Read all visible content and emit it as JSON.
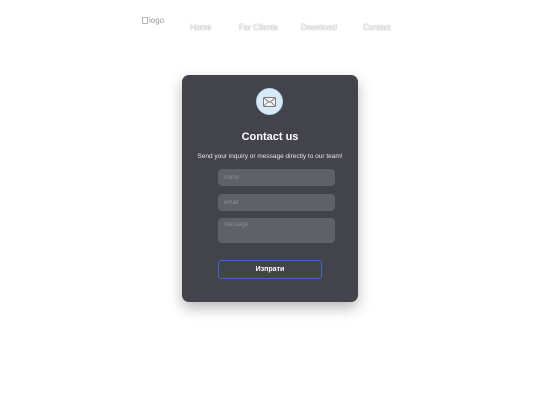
{
  "nav": {
    "logo_alt": "logo",
    "items": [
      "Home",
      "For Clients",
      "Download",
      "Contact"
    ]
  },
  "contact": {
    "icon": "envelope-icon",
    "title": "Contact us",
    "subtitle": "Send your inquiry or message directly to our team!",
    "name_placeholder": "name",
    "email_placeholder": "email",
    "message_placeholder": "message",
    "submit_label": "Изпрати"
  },
  "colors": {
    "card_bg": "#43434b",
    "field_bg": "#606068",
    "icon_circle": "#d7eaf8",
    "button_border": "#3a6bc4"
  }
}
